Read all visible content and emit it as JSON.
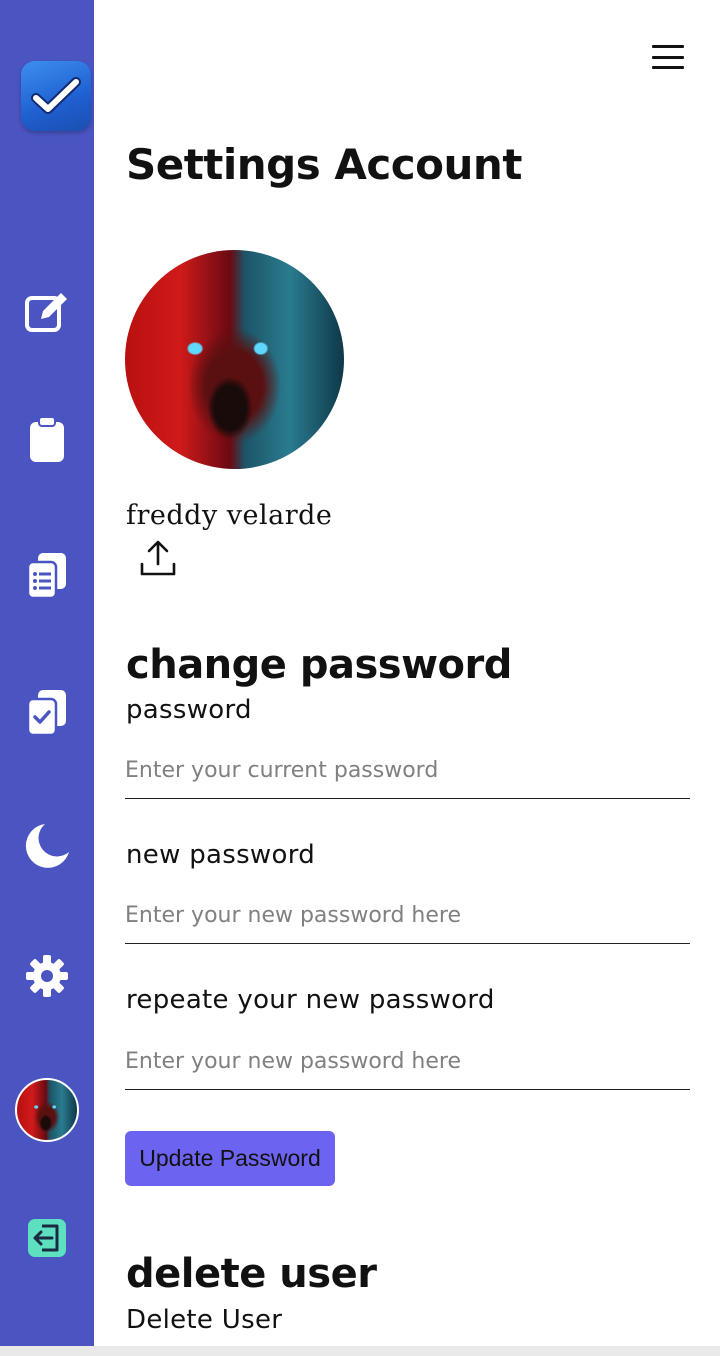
{
  "sidebar": {
    "logo_icon": "checkmark-app-icon",
    "items": [
      {
        "icon": "edit-note-icon"
      },
      {
        "icon": "clipboard-icon"
      },
      {
        "icon": "clipboard-list-icon"
      },
      {
        "icon": "clipboard-check-icon"
      },
      {
        "icon": "moon-icon"
      },
      {
        "icon": "gear-icon"
      },
      {
        "icon": "avatar"
      },
      {
        "icon": "logout-icon"
      }
    ],
    "color": "#4a55c2"
  },
  "header": {
    "menu_icon": "hamburger-menu-icon",
    "title": "Settings Account"
  },
  "profile": {
    "name": "freddy velarde",
    "upload_icon": "upload-icon"
  },
  "change_password": {
    "heading": "change password",
    "fields": [
      {
        "label": "password",
        "placeholder": "Enter your current password",
        "value": ""
      },
      {
        "label": "new password",
        "placeholder": "Enter your new password here",
        "value": ""
      },
      {
        "label": "repeate your new password",
        "placeholder": "Enter your new password here",
        "value": ""
      }
    ],
    "button_label": "Update Password",
    "button_color": "#6c63f0"
  },
  "delete_user": {
    "heading": "delete user",
    "label": "Delete User"
  }
}
